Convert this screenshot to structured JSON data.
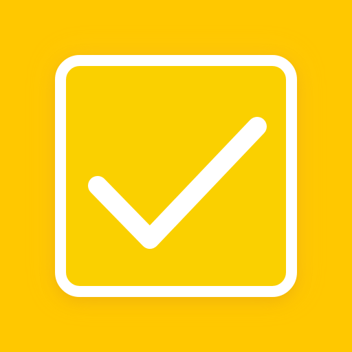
{
  "app": {
    "icon": "checkbox-checked-icon",
    "checked": true
  },
  "colors": {
    "background": "#FFC800",
    "box_fill": "#FAD000",
    "box_border": "#FFFFFF",
    "checkmark": "#FFFFFF"
  }
}
